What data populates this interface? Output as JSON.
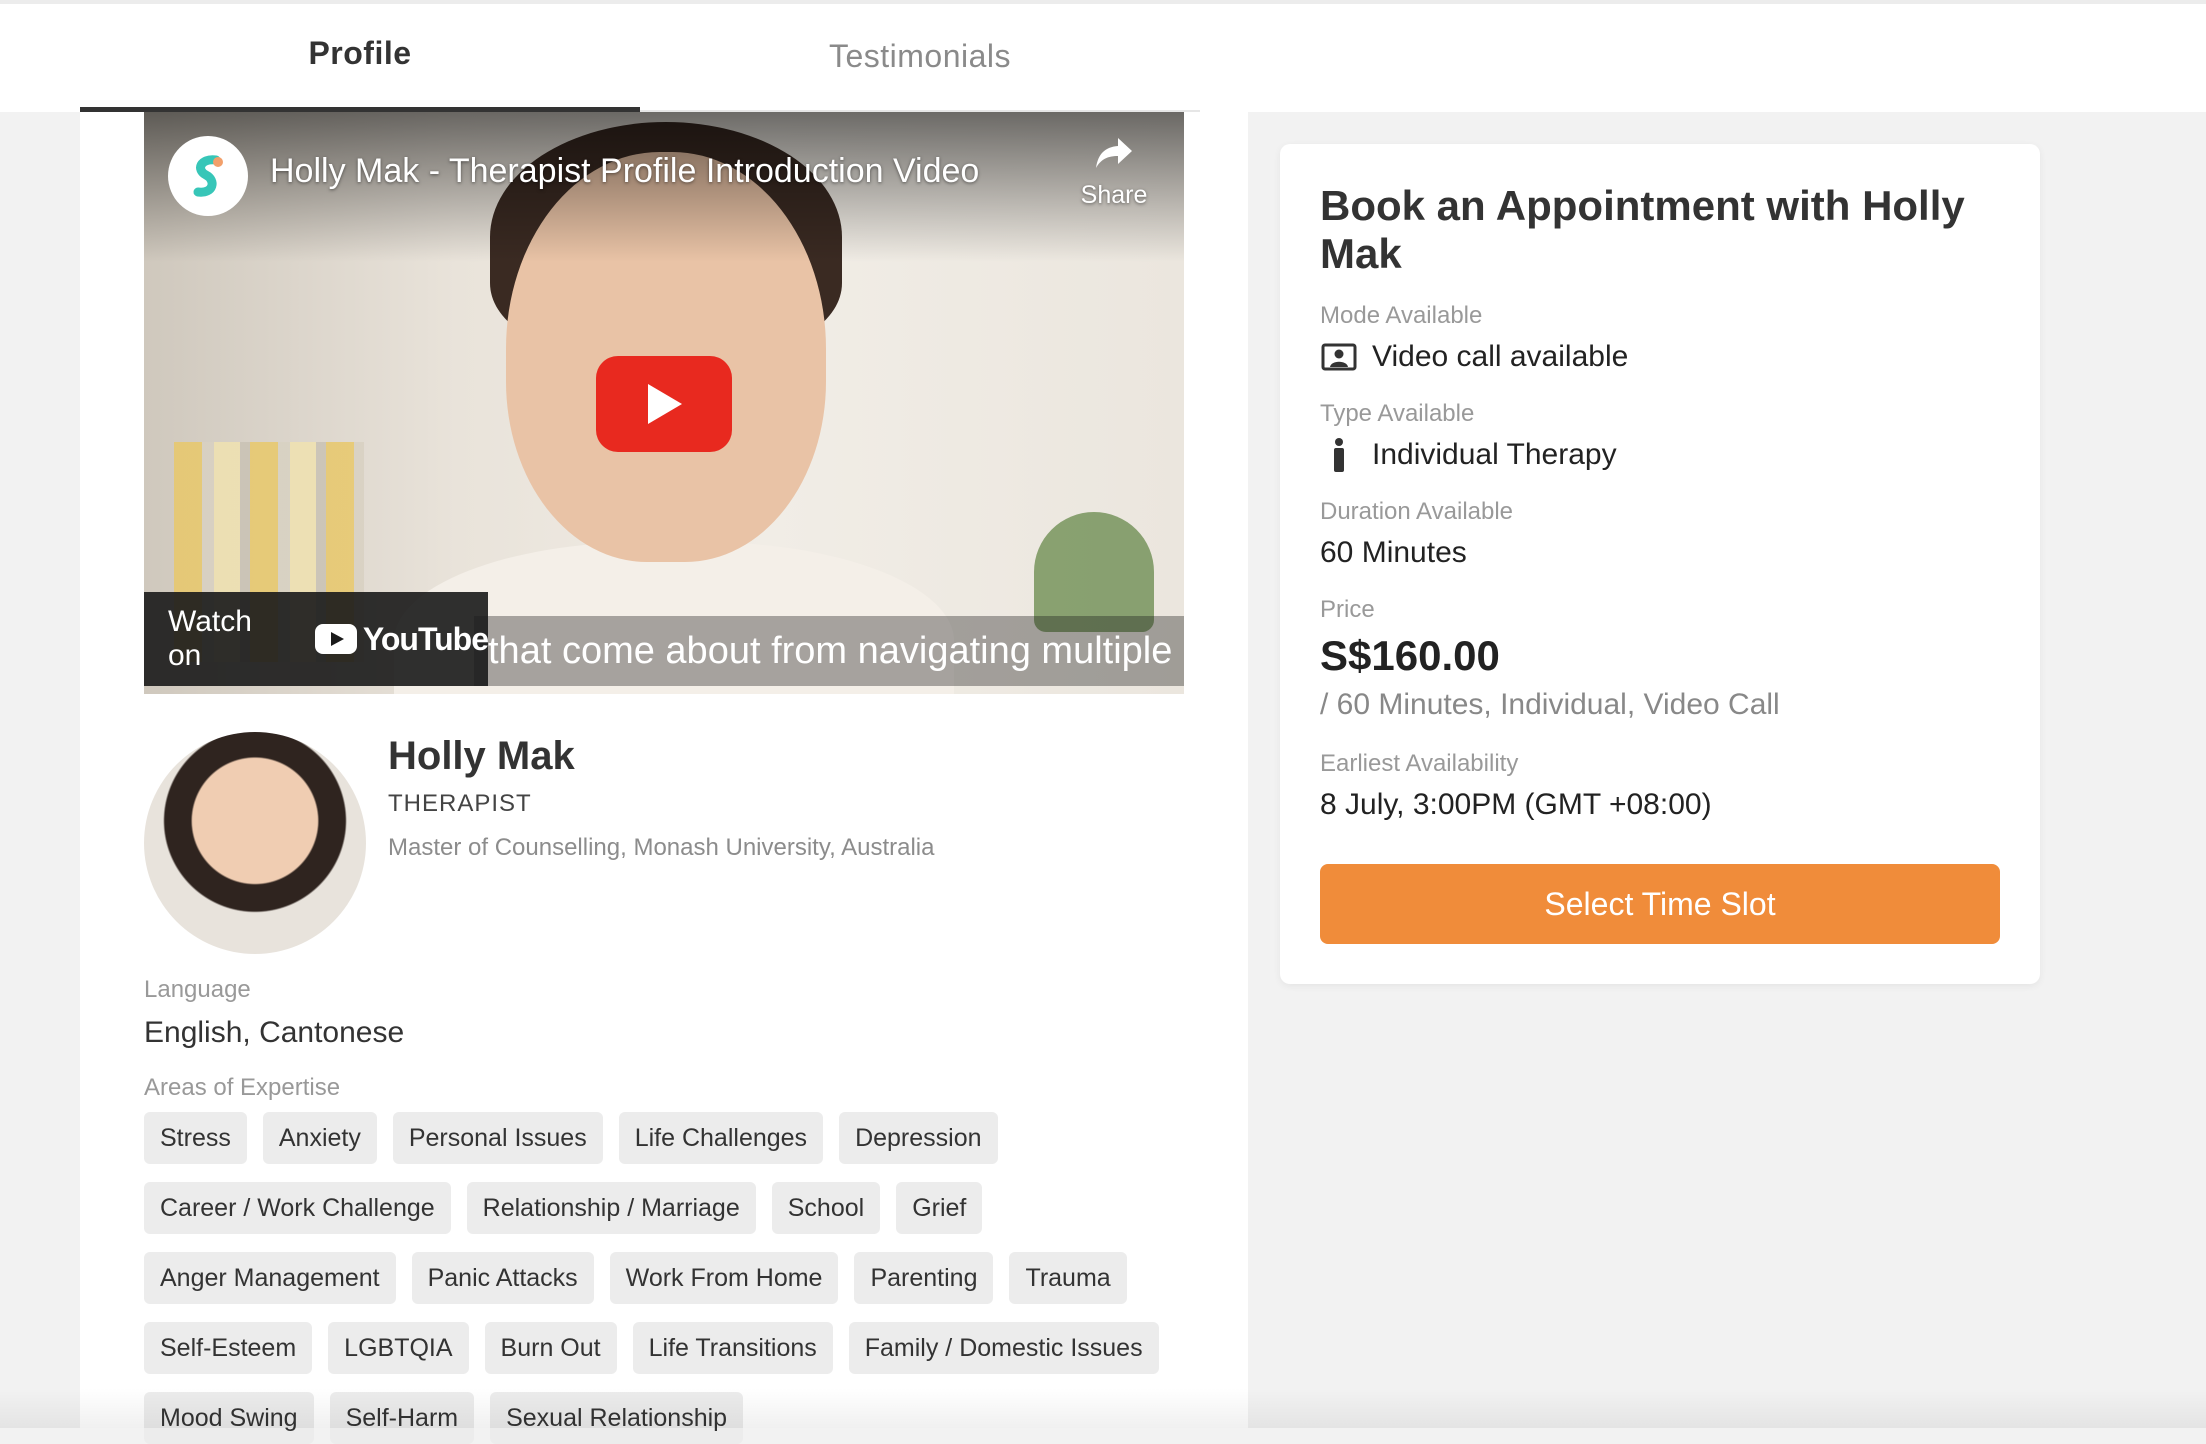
{
  "tabs": [
    {
      "label": "Profile",
      "active": true
    },
    {
      "label": "Testimonials",
      "active": false
    }
  ],
  "video": {
    "title": "Holly Mak - Therapist Profile Introduction Video",
    "share_label": "Share",
    "caption": "that come about from navigating multiple cultures",
    "watch_label": "Watch on",
    "youtube_label": "YouTube",
    "play_color": "#e8291f"
  },
  "profile": {
    "name": "Holly Mak",
    "role": "THERAPIST",
    "qualification": "Master of Counselling, Monash University, Australia",
    "language_label": "Language",
    "language_value": "English, Cantonese",
    "expertise_label": "Areas of Expertise",
    "expertise": [
      "Stress",
      "Anxiety",
      "Personal Issues",
      "Life Challenges",
      "Depression",
      "Career / Work Challenge",
      "Relationship / Marriage",
      "School",
      "Grief",
      "Anger Management",
      "Panic Attacks",
      "Work From Home",
      "Parenting",
      "Trauma",
      "Self-Esteem",
      "LGBTQIA",
      "Burn Out",
      "Life Transitions",
      "Family / Domestic Issues",
      "Mood Swing",
      "Self-Harm",
      "Sexual Relationship"
    ]
  },
  "booking": {
    "title": "Book an Appointment with Holly Mak",
    "mode_label": "Mode Available",
    "mode_value": "Video call available",
    "mode_icon": "video-call-icon",
    "type_label": "Type Available",
    "type_value": "Individual Therapy",
    "type_icon": "person-icon",
    "duration_label": "Duration Available",
    "duration_value": "60 Minutes",
    "price_label": "Price",
    "price_value": "S$160.00",
    "price_note": "/ 60 Minutes, Individual, Video Call",
    "availability_label": "Earliest Availability",
    "availability_value": "8 July, 3:00PM (GMT +08:00)",
    "button_label": "Select Time Slot",
    "button_color": "#f08c3a"
  }
}
